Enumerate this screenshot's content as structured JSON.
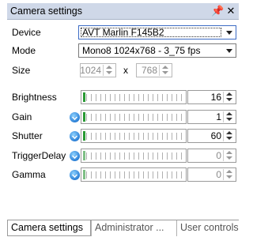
{
  "window": {
    "title": "Camera settings",
    "pin_icon": "pin-icon",
    "close_icon": "close-icon"
  },
  "fields": {
    "device_label": "Device",
    "device_value": "AVT Marlin F145B2",
    "mode_label": "Mode",
    "mode_value": "Mono8 1024x768 - 3_75 fps",
    "size_label": "Size",
    "size_width": "1024",
    "size_height": "768",
    "size_separator": "x"
  },
  "properties": [
    {
      "label": "Brightness",
      "value": "16",
      "auto": false,
      "enabled": true,
      "level": 0.0
    },
    {
      "label": "Gain",
      "value": "1",
      "auto": true,
      "enabled": true,
      "level": 0.0
    },
    {
      "label": "Shutter",
      "value": "60",
      "auto": true,
      "enabled": true,
      "level": 0.0
    },
    {
      "label": "TriggerDelay",
      "value": "0",
      "auto": true,
      "enabled": false,
      "level": 0.0
    },
    {
      "label": "Gamma",
      "value": "0",
      "auto": true,
      "enabled": false,
      "level": 0.0
    }
  ],
  "tabs": [
    {
      "label": "Camera settings",
      "active": true
    },
    {
      "label": "Administrator ...",
      "active": false
    },
    {
      "label": "User controls",
      "active": false
    }
  ],
  "colors": {
    "title_bar": "#cfd8e8",
    "slider_thumb": "#2a9a35",
    "auto_icon": "#2a7fd6"
  }
}
